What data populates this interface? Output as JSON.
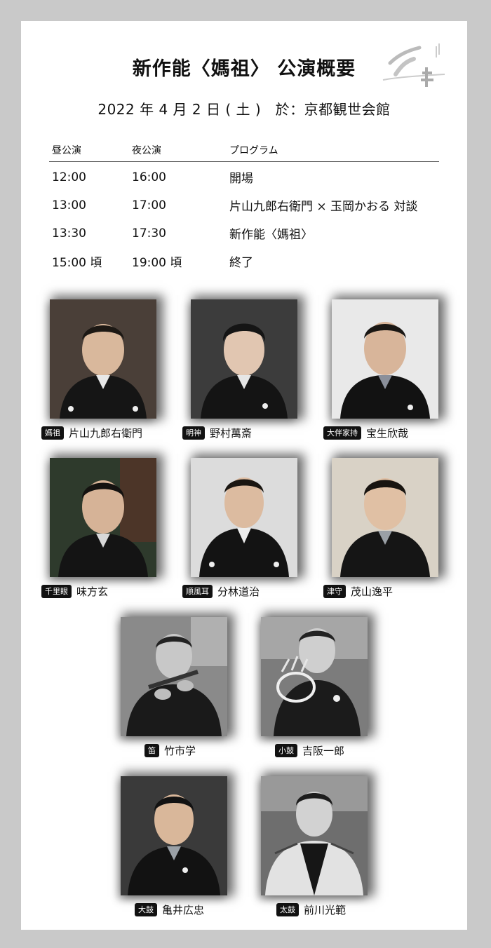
{
  "title": "新作能〈媽祖〉 公演概要",
  "subtitle": "2022 年 4 月 2 日 ( 土 )　於：京都観世会館",
  "schedule": {
    "headers": [
      "昼公演",
      "夜公演",
      "プログラム"
    ],
    "rows": [
      [
        "12:00",
        "16:00",
        "開場"
      ],
      [
        "13:00",
        "17:00",
        "片山九郎右衛門 × 玉岡かおる 対談"
      ],
      [
        "13:30",
        "17:30",
        "新作能〈媽祖〉"
      ],
      [
        "15:00 頃",
        "19:00 頃",
        "終了"
      ]
    ]
  },
  "cast": [
    {
      "role": "媽祖",
      "name": "片山九郎右衛門"
    },
    {
      "role": "明神",
      "name": "野村萬斎"
    },
    {
      "role": "大伴家持",
      "name": "宝生欣哉"
    },
    {
      "role": "千里眼",
      "name": "味方玄"
    },
    {
      "role": "順風耳",
      "name": "分林道治"
    },
    {
      "role": "津守",
      "name": "茂山逸平"
    },
    {
      "role": "笛",
      "name": "竹市学"
    },
    {
      "role": "小鼓",
      "name": "吉阪一郎"
    },
    {
      "role": "大鼓",
      "name": "亀井広忠"
    },
    {
      "role": "太鼓",
      "name": "前川光範"
    }
  ],
  "colors": {
    "background": "#c9c9c9",
    "card": "#ffffff",
    "badge": "#111111"
  }
}
